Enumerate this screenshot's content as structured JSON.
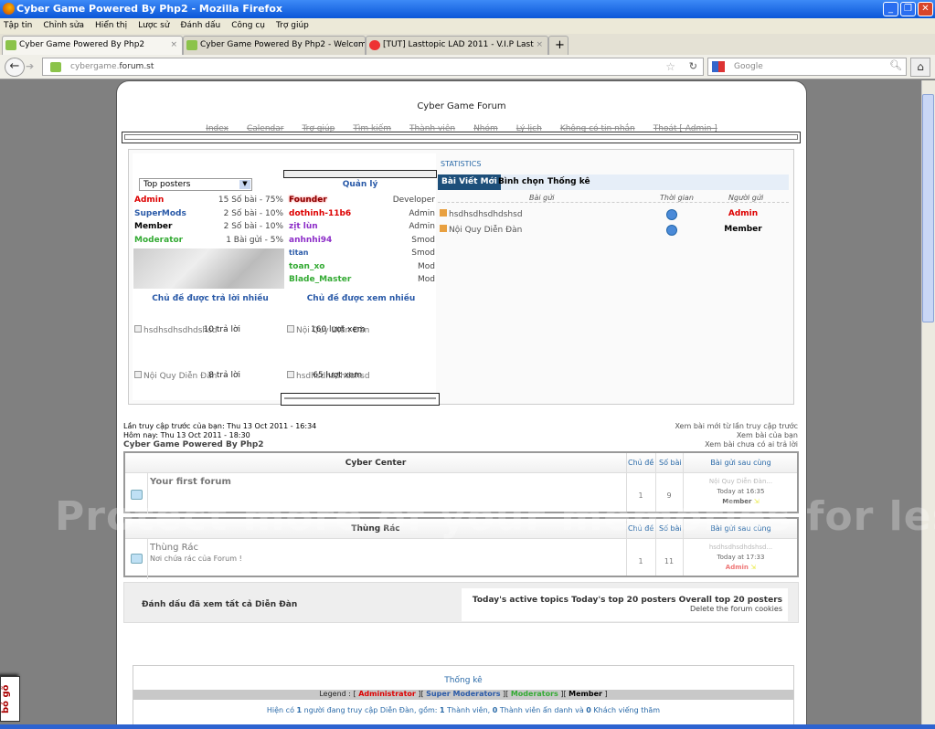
{
  "window": {
    "title": "Cyber Game Powered By Php2 - Mozilla Firefox"
  },
  "menu": [
    "Tập tin",
    "Chỉnh sửa",
    "Hiển thị",
    "Lược sử",
    "Đánh dấu",
    "Công cụ",
    "Trợ giúp"
  ],
  "tabs": [
    {
      "label": "Cyber Game Powered By Php2",
      "active": true
    },
    {
      "label": "Cyber Game Powered By Php2 - Welcom..."
    },
    {
      "label": "[TUT] Lasttopic LAD 2011 - V.I.P Last"
    }
  ],
  "url": {
    "sub": "cybergame.",
    "domain": "forum.st"
  },
  "search": {
    "placeholder": "Google"
  },
  "forum": {
    "title": "Cyber Game Forum",
    "nav": [
      "Index",
      "Calendar",
      "Trợ giúp",
      "Tìm kiếm",
      "Thành viên",
      "Nhóm",
      "Lý lịch",
      "Không có tin nhắn",
      "Thoát [ Admin ]"
    ],
    "top_select": "Top posters",
    "posters": [
      {
        "name": "Admin",
        "stat": "15 Số bài - 75%",
        "cls": "red"
      },
      {
        "name": "SuperMods",
        "stat": "2 Số bài - 10%",
        "cls": "blue"
      },
      {
        "name": "Member",
        "stat": "2 Số bài - 10%",
        "cls": "blk"
      },
      {
        "name": "Moderator",
        "stat": "1 Bài gửi - 5%",
        "cls": "grn"
      }
    ],
    "staff_title": "Quản lý",
    "staff": [
      {
        "name": "Founder",
        "role": "Developer",
        "cls": "red"
      },
      {
        "name": "dothinh-11b6",
        "role": "Admin",
        "cls": "red"
      },
      {
        "name": "zịt lùn",
        "role": "Admin",
        "cls": "pur"
      },
      {
        "name": "anhnhi94",
        "role": "Smod",
        "cls": "pur"
      },
      {
        "name": "titan",
        "role": "Smod",
        "cls": "blue"
      },
      {
        "name": "toan_xo",
        "role": "Mod",
        "cls": "grn"
      },
      {
        "name": "Blade_Master",
        "role": "Mod",
        "cls": "grn"
      }
    ],
    "most_replied": {
      "title": "Chủ đề được trả lời nhiều",
      "items": [
        {
          "topic": "hsdhsdhsdhdshsd",
          "count": "10 trả lời"
        },
        {
          "topic": "Nội Quy Diễn Đàn",
          "count": "8 trả lời"
        }
      ]
    },
    "most_viewed": {
      "title": "Chủ đề được xem nhiều",
      "items": [
        {
          "topic": "Nội Quy Diễn Đàn",
          "count": "160 lượt xem"
        },
        {
          "topic": "hsdhsdhsdhdshsd",
          "count": "65 lượt xem"
        }
      ]
    },
    "stats_title": "STATISTICS",
    "stats_tabs": [
      "Bài Viết Mới",
      "Bình chọn",
      "Thống kê"
    ],
    "stats_headers": [
      "Bài gửi",
      "Thời gian",
      "Người gửi"
    ],
    "stats_rows": [
      {
        "topic": "hsdhsdhsdhdshsd",
        "user": "Admin",
        "cls": "red"
      },
      {
        "topic": "Nội Quy Diễn Đàn",
        "user": "Member",
        "cls": "blk"
      }
    ],
    "last_visit": "Lần truy cập trước của bạn: Thu 13 Oct 2011 - 16:34",
    "today": "Hôm nay: Thu 13 Oct 2011 - 18:30",
    "site_name": "Cyber Game Powered By Php2",
    "quick_links": [
      "Xem bài mới từ lần truy cập trước",
      "Xem bài của bạn",
      "Xem bài chưa có ai trả lời"
    ],
    "col_headers": {
      "topics": "Chủ đề",
      "posts": "Số bài",
      "last": "Bài gửi sau cùng"
    },
    "categories": [
      {
        "name": "Cyber Center",
        "forum": "Your first forum",
        "desc": "",
        "topics": "1",
        "posts": "9",
        "last_topic": "Nội Quy Diễn Đàn...",
        "last_time": "Today at 16:35",
        "last_user": "Member"
      },
      {
        "name": "Thùng Rác",
        "forum": "Thùng Rác",
        "desc": "Nơi chứa rác của Forum !",
        "topics": "1",
        "posts": "11",
        "last_topic": "hsdhsdhsdhdshsd...",
        "last_time": "Today at 17:33",
        "last_user": "Admin"
      }
    ],
    "mark_read": "Đánh dấu đã xem tất cả Diễn Đàn",
    "top_links": "Today's active topics Today's top 20 posters Overall top 20 posters",
    "delete_cookies": "Delete the forum cookies",
    "stats_box_title": "Thống kê",
    "legend": {
      "label": "Legend :",
      "admin": "Administrator",
      "smod": "Super Moderators",
      "mod": "Moderators",
      "member": "Member"
    },
    "online": {
      "a": "Hiện có ",
      "n1": "1",
      "b": " người đang truy cập Diễn Đàn, gồm: ",
      "n2": "1",
      "c": " Thành viên, ",
      "n3": "0",
      "d": " Thành viên ẩn danh và ",
      "n4": "0",
      "e": " Khách viếng thăm"
    }
  },
  "watermark": "Protect more of your memories for less!",
  "badge": "bỏ gõ"
}
